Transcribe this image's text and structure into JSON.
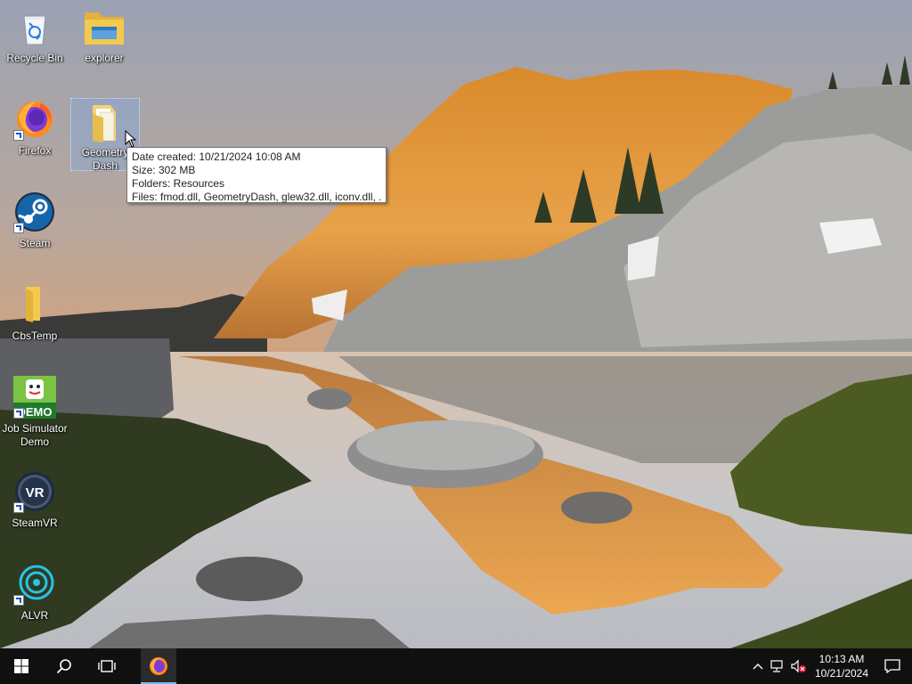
{
  "desktop": {
    "icons": [
      {
        "label": "Recycle Bin",
        "icon": "recycle-bin-icon"
      },
      {
        "label": "explorer",
        "icon": "folder-icon"
      },
      {
        "label": "Firefox",
        "icon": "firefox-icon"
      },
      {
        "label": "Geometry Dash",
        "icon": "folder-icon"
      },
      {
        "label": "Steam",
        "icon": "steam-icon"
      },
      {
        "label": "CbsTemp",
        "icon": "folder-icon"
      },
      {
        "label": "Job Simulator Demo",
        "icon": "job-simulator-icon"
      },
      {
        "label": "SteamVR",
        "icon": "steamvr-icon"
      },
      {
        "label": "ALVR",
        "icon": "alvr-icon"
      }
    ],
    "job_sim_badge": "DEMO",
    "steamvr_badge": "VR"
  },
  "tooltip": {
    "date_created": "Date created: 10/21/2024 10:08 AM",
    "size": "Size: 302 MB",
    "folders": "Folders: Resources",
    "files": "Files: fmod.dll, GeometryDash, glew32.dll, iconv.dll, ..."
  },
  "taskbar": {
    "pinned": [
      "start-icon",
      "search-icon",
      "task-view-icon",
      "firefox-icon"
    ],
    "tray": {
      "time": "10:13 AM",
      "date": "10/21/2024"
    }
  },
  "colors": {
    "taskbar_bg": "#101010",
    "active_indicator": "#76b9ed",
    "folder_yellow": "#f3c94e"
  }
}
